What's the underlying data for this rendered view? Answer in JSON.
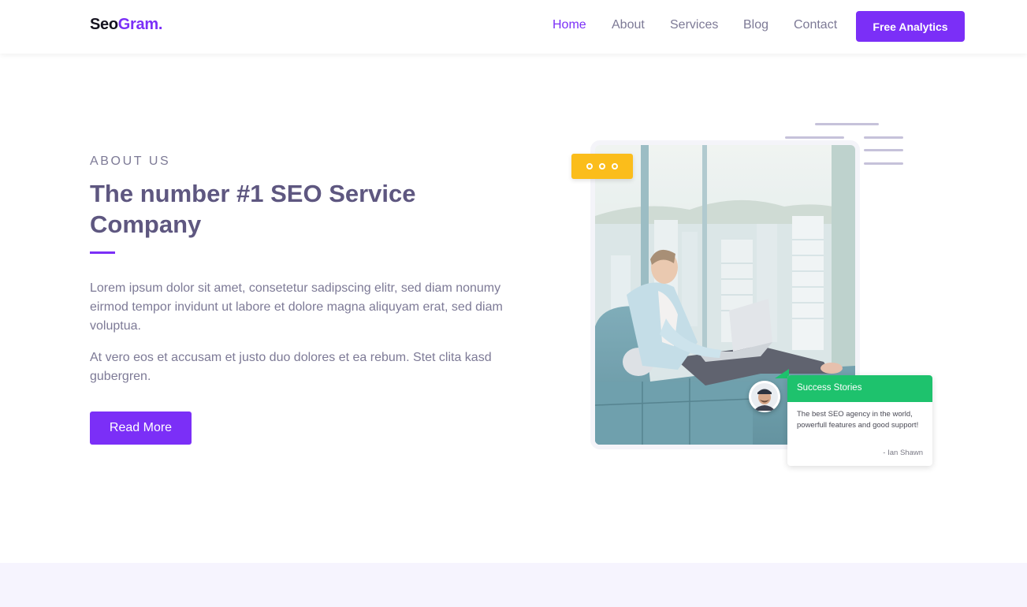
{
  "brand": {
    "name_part1": "Seo",
    "name_part2": "Gram."
  },
  "nav": {
    "items": [
      {
        "label": "Home"
      },
      {
        "label": "About"
      },
      {
        "label": "Services"
      },
      {
        "label": "Blog"
      },
      {
        "label": "Contact"
      }
    ],
    "active": "Home",
    "cta_label": "Free Analytics"
  },
  "about": {
    "eyebrow": "ABOUT US",
    "heading": "The number #1 SEO Service Company",
    "paragraph1": "Lorem ipsum dolor sit amet, consetetur sadipscing elitr, sed diam nonumy eirmod tempor invidunt ut labore et dolore magna aliquyam erat, sed diam voluptua.",
    "paragraph2": "At vero eos et accusam et justo duo dolores et ea rebum. Stet clita kasd gubergren.",
    "button_label": "Read More"
  },
  "testimonial": {
    "title": "Success Stories",
    "text": "The best SEO agency in the world, powerfull features and good support!",
    "author": "- Ian Shawn"
  },
  "colors": {
    "accent": "#7b2ff7",
    "heading": "#5e5780",
    "badge_yellow": "#fbbd1b",
    "success_green": "#1ec26d",
    "band": "#f6f4fe"
  },
  "icons": {
    "badge": "three-dots-icon",
    "avatar": "user-avatar-icon"
  }
}
